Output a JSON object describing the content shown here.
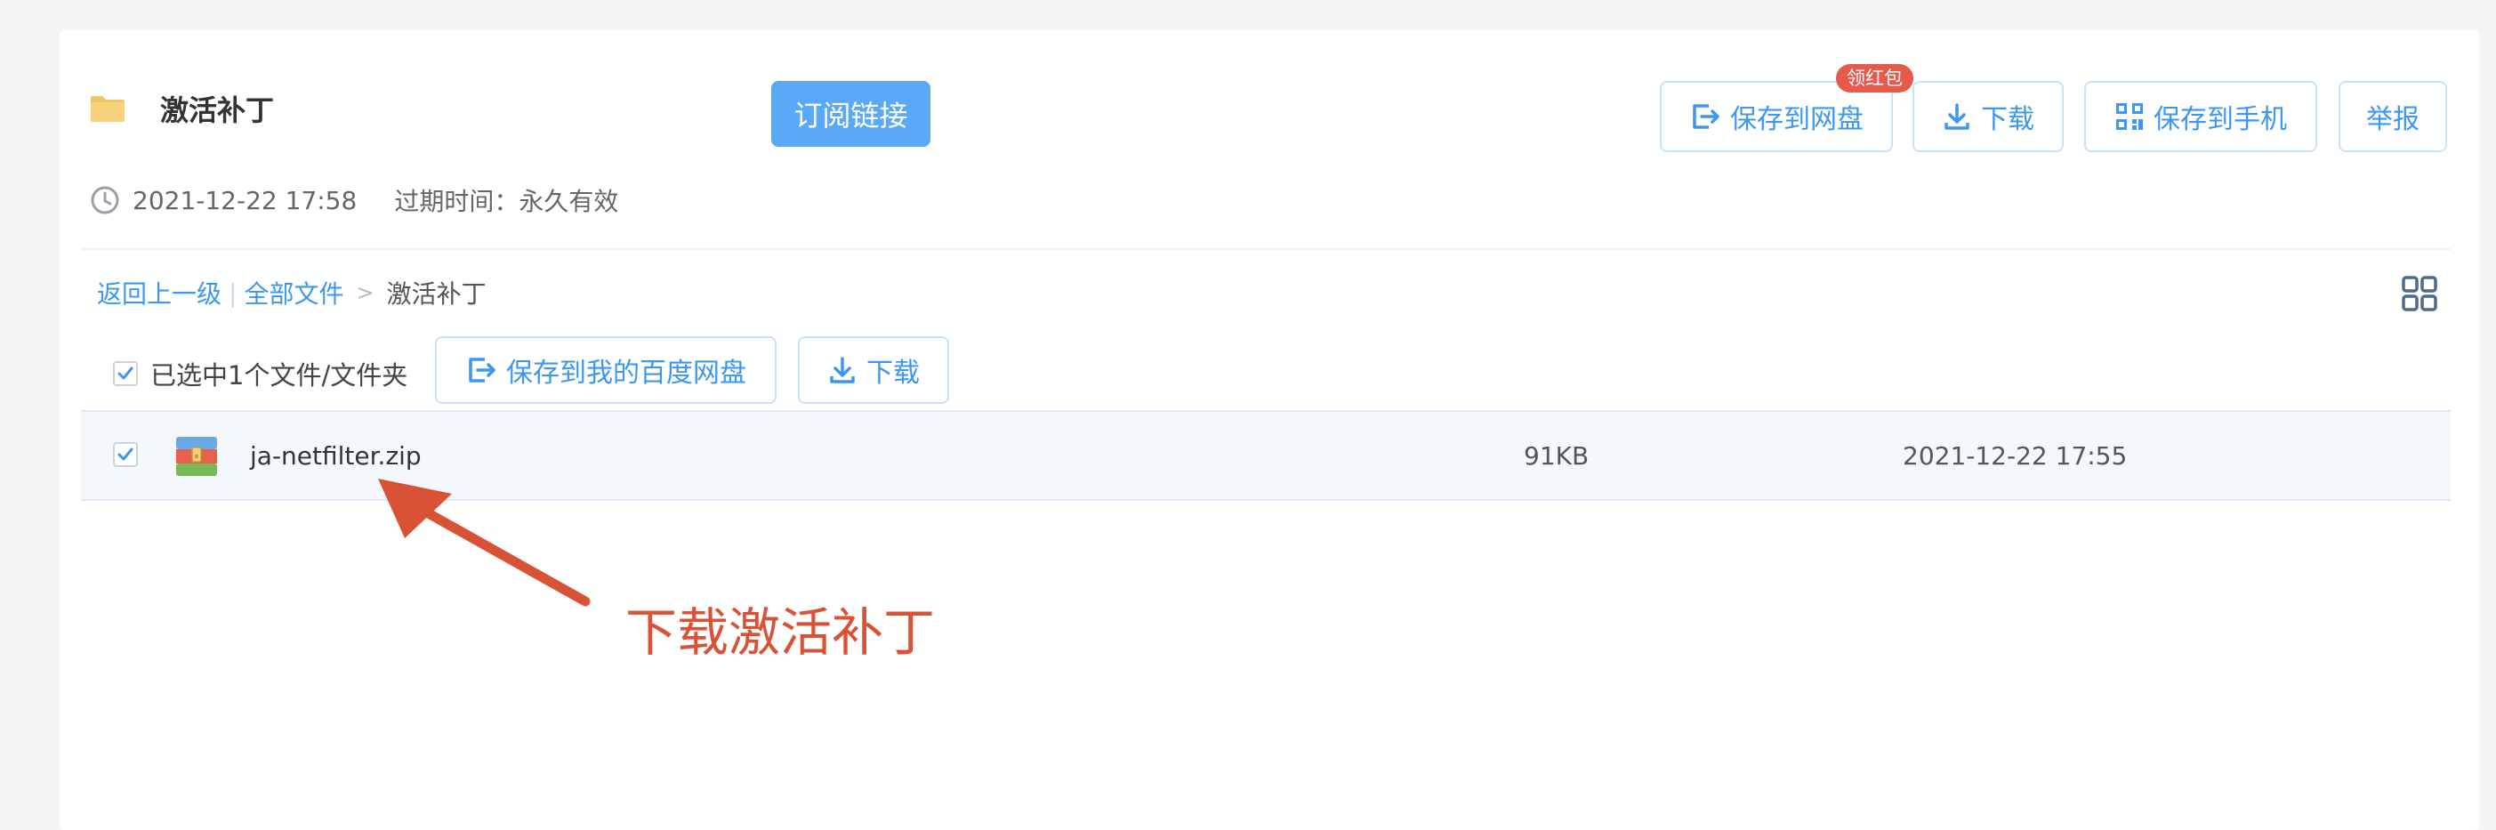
{
  "share": {
    "title": "激活补丁",
    "subscribe_label": "订阅链接",
    "created": "2021-12-22 17:58",
    "expire": "过期时间：永久有效"
  },
  "actions": {
    "save_to_disk": "保存到网盘",
    "badge": "领红包",
    "download": "下载",
    "save_to_phone": "保存到手机",
    "report": "举报"
  },
  "breadcrumb": {
    "back": "返回上一级",
    "all_files": "全部文件",
    "arrow": ">",
    "current": "激活补丁"
  },
  "selection": {
    "status": "已选中1个文件/文件夹",
    "save_to_mine": "保存到我的百度网盘",
    "download": "下载"
  },
  "files": [
    {
      "name": "ja-netfilter.zip",
      "size": "91KB",
      "date": "2021-12-22 17:55",
      "checked": true
    }
  ],
  "annotation": {
    "text": "下载激活补丁",
    "color": "#d95236"
  },
  "colors": {
    "accent": "#3b97f2",
    "subscribe_bg": "#5aa9f8",
    "badge_bg": "#e55a4b"
  },
  "icons": [
    "folder-icon",
    "clock-icon",
    "save-to-disk-icon",
    "download-icon",
    "qr-code-icon",
    "grid-view-icon",
    "checkbox-checked-icon",
    "zip-file-icon",
    "annotation-arrow"
  ]
}
